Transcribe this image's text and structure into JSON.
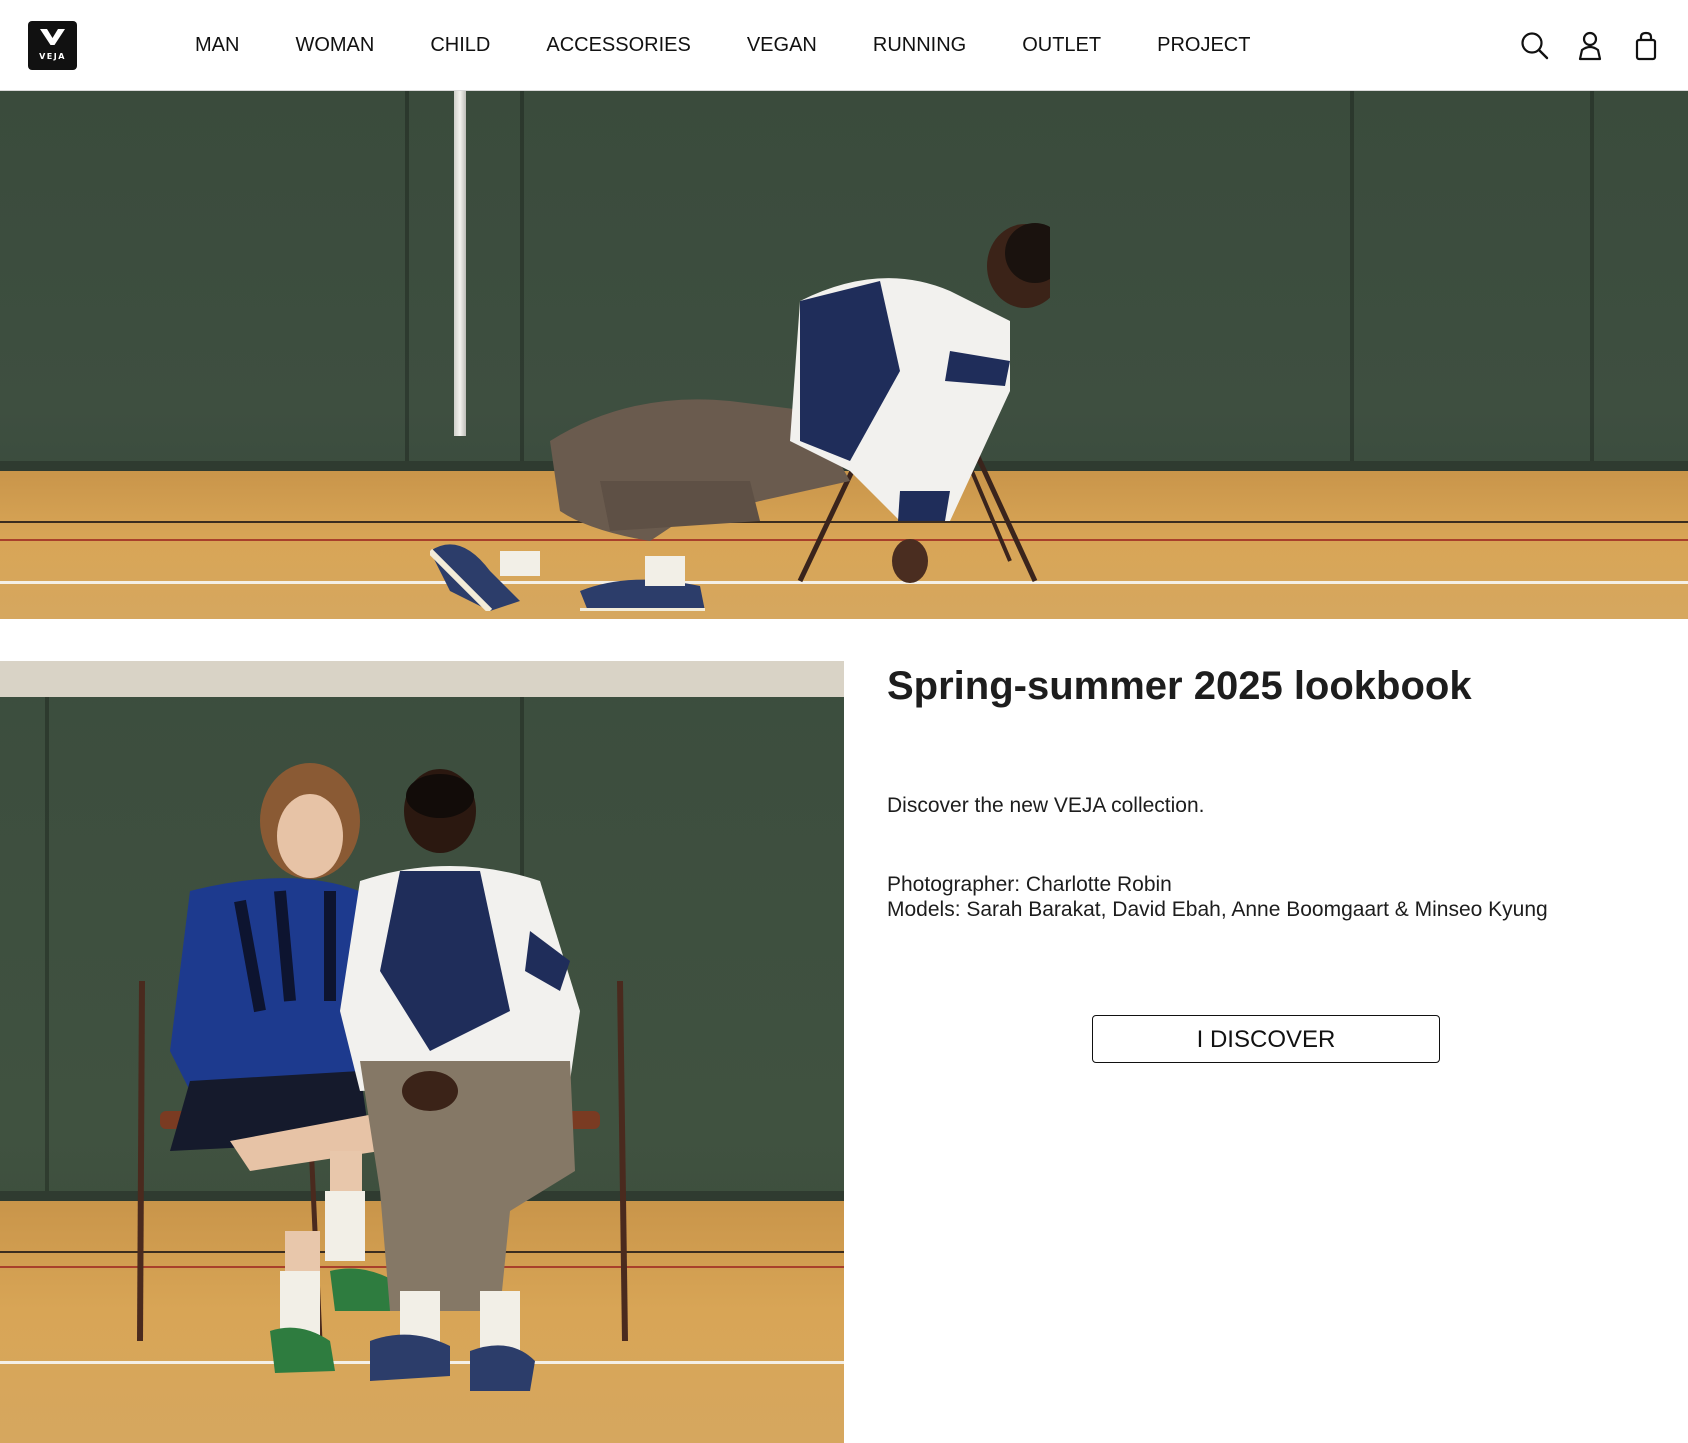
{
  "brand": {
    "logo_text": "VEJA"
  },
  "nav": {
    "items": [
      {
        "label": "MAN"
      },
      {
        "label": "WOMAN"
      },
      {
        "label": "CHILD"
      },
      {
        "label": "ACCESSORIES"
      },
      {
        "label": "VEGAN"
      },
      {
        "label": "RUNNING"
      },
      {
        "label": "OUTLET"
      },
      {
        "label": "PROJECT"
      }
    ]
  },
  "header_icons": [
    "search-icon",
    "account-icon",
    "bag-icon"
  ],
  "lookbook": {
    "title": "Spring-summer 2025 lookbook",
    "description": "Discover the new VEJA collection.",
    "photographer": "Photographer: Charlotte Robin",
    "models": "Models: Sarah Barakat, David Ebah, Anne Boomgaart & Minseo Kyung",
    "cta_label": "I DISCOVER"
  },
  "colors": {
    "text": "#1d1d1d",
    "wall_green": "#3e4f40",
    "court_floor": "#d8a556",
    "jacket_navy": "#1f2d5a"
  }
}
